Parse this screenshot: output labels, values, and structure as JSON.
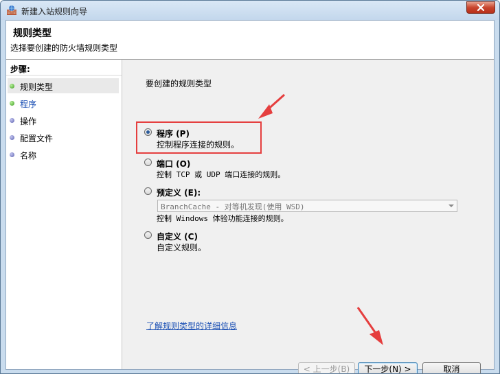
{
  "window": {
    "title": "新建入站规则向导"
  },
  "header": {
    "title": "规则类型",
    "subtitle": "选择要创建的防火墙规则类型"
  },
  "steps": {
    "title": "步骤:",
    "items": [
      {
        "label": "规则类型",
        "bullet": "green",
        "active": true
      },
      {
        "label": "程序",
        "bullet": "green",
        "link": true
      },
      {
        "label": "操作",
        "bullet": "purple"
      },
      {
        "label": "配置文件",
        "bullet": "purple"
      },
      {
        "label": "名称",
        "bullet": "purple"
      }
    ]
  },
  "main": {
    "question": "要创建的规则类型",
    "options": [
      {
        "label": "程序 (P)",
        "desc": "控制程序连接的规则。",
        "checked": true
      },
      {
        "label": "端口 (O)",
        "desc": "控制 TCP 或 UDP 端口连接的规则。",
        "checked": false
      },
      {
        "label": "预定义 (E):",
        "desc": "控制 Windows 体验功能连接的规则。",
        "checked": false
      },
      {
        "label": "自定义 (C)",
        "desc": "自定义规则。",
        "checked": false
      }
    ],
    "predefined_select": "BranchCache - 对等机发现(使用 WSD)",
    "info_link": "了解规则类型的详细信息"
  },
  "buttons": {
    "back": "< 上一步(B)",
    "next": "下一步(N) >",
    "cancel": "取消"
  },
  "colors": {
    "annotation": "#e53e3e",
    "link": "#1a4fb4"
  }
}
